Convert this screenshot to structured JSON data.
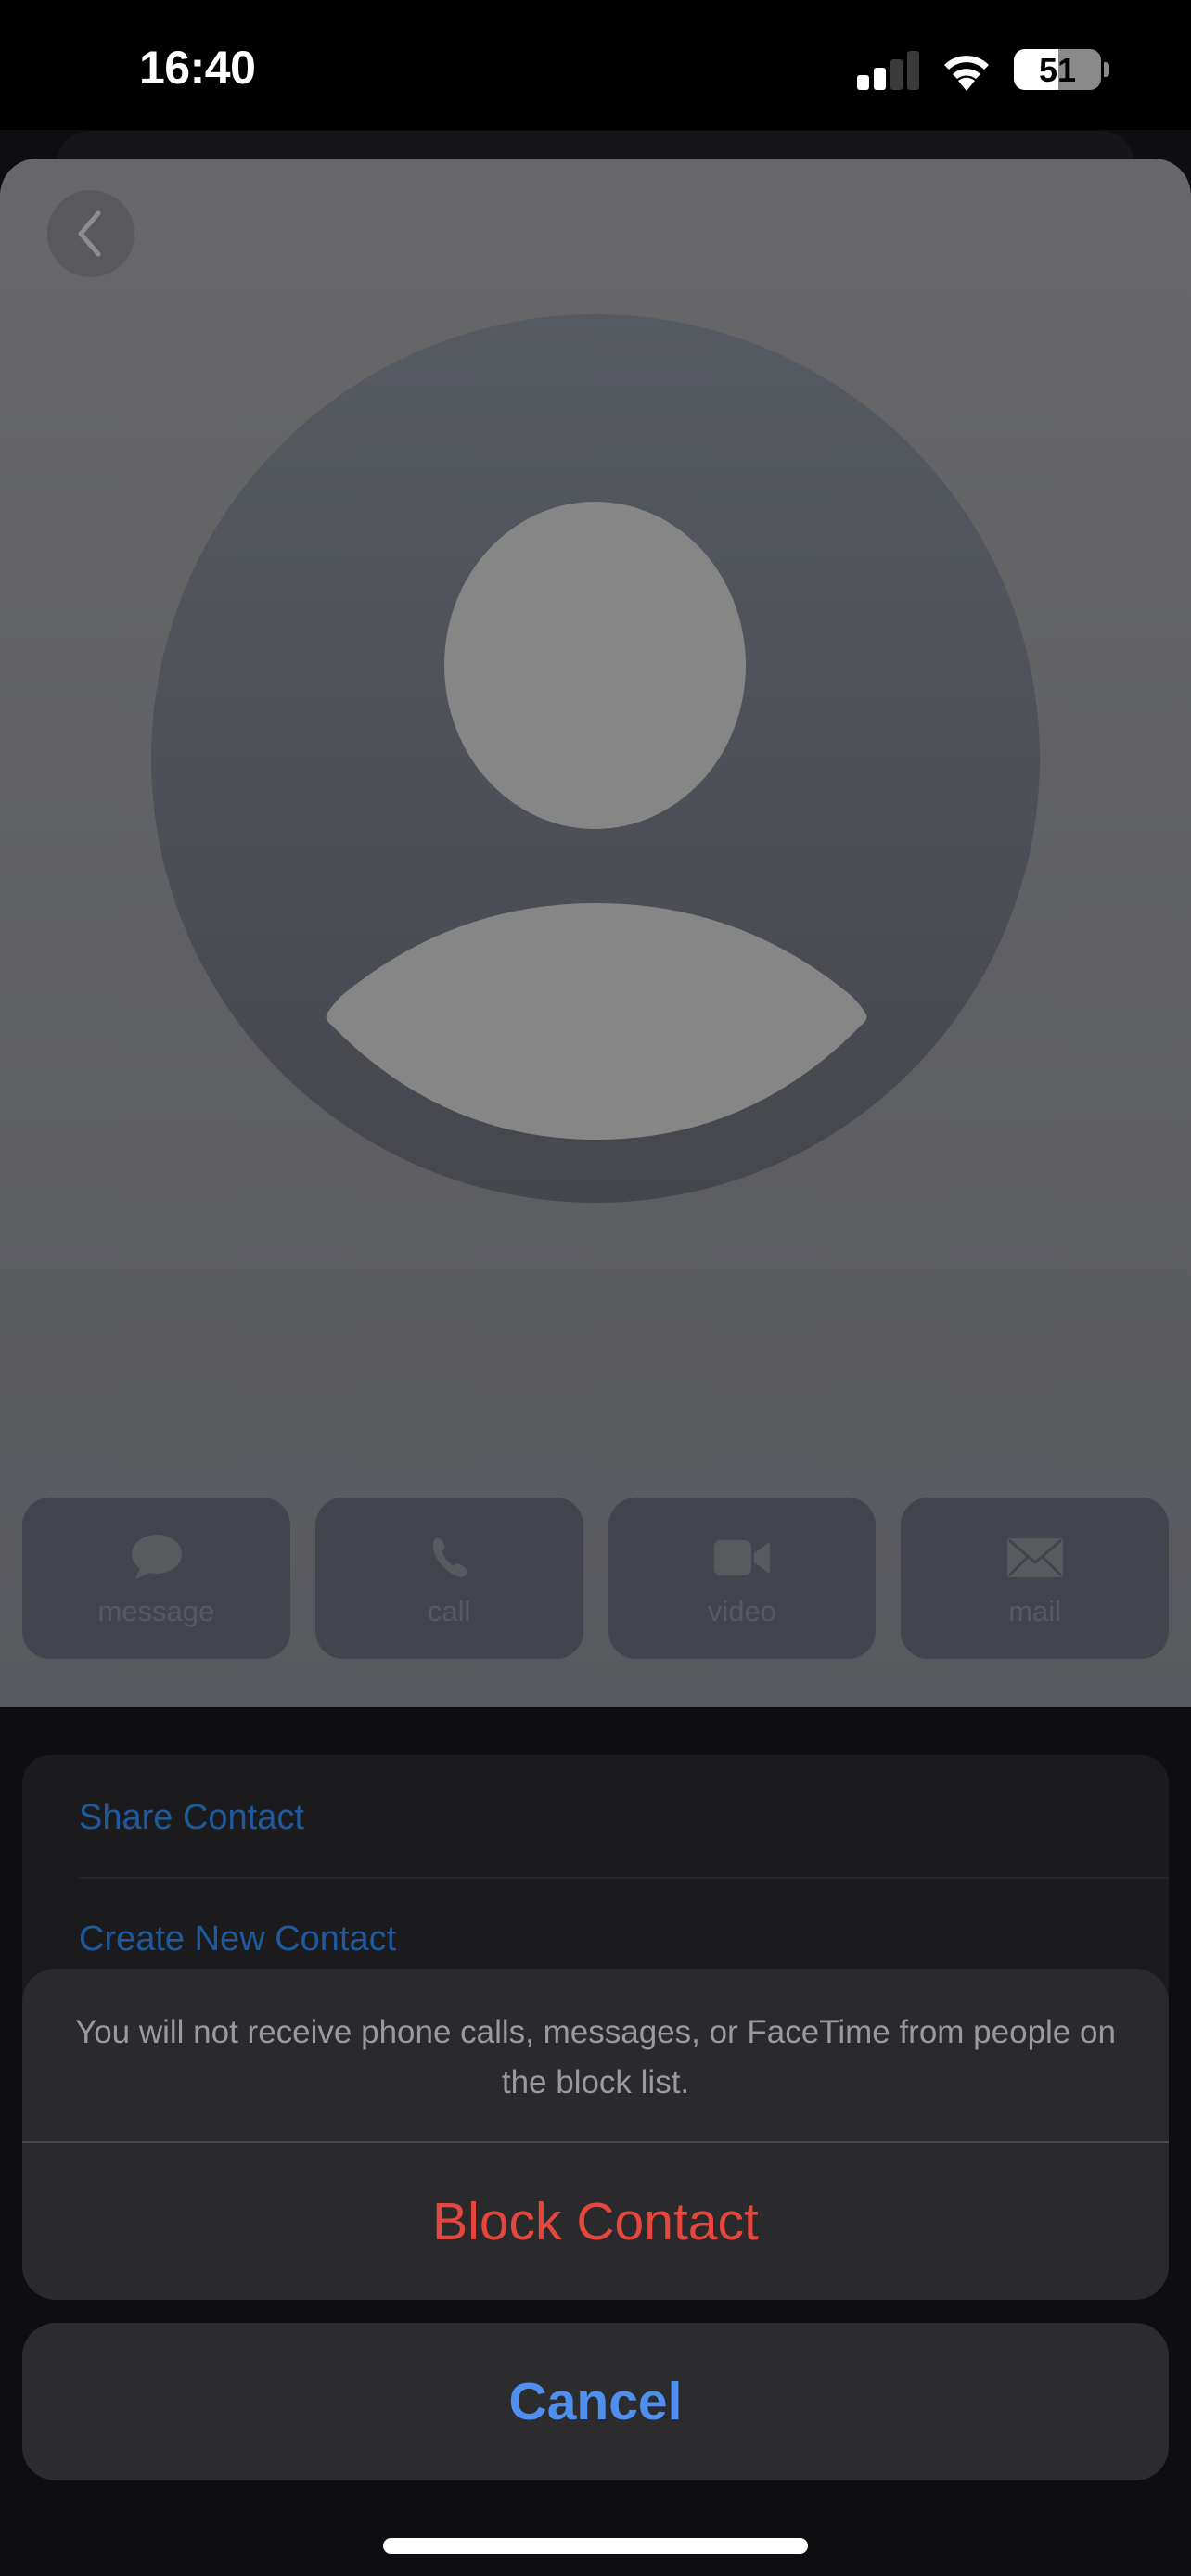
{
  "status_bar": {
    "time": "16:40",
    "signal_bars_active": 2,
    "signal_bars_total": 4,
    "wifi_icon": "wifi-icon",
    "battery_percent": 51,
    "battery_label": "51"
  },
  "contact_card": {
    "back_icon": "chevron-left-icon",
    "avatar_icon": "person-placeholder-icon",
    "actions": [
      {
        "label": "message",
        "icon": "message-bubble-icon"
      },
      {
        "label": "call",
        "icon": "phone-icon"
      },
      {
        "label": "video",
        "icon": "video-camera-icon"
      },
      {
        "label": "mail",
        "icon": "envelope-icon"
      }
    ]
  },
  "list": {
    "items": [
      {
        "label": "Share Contact"
      },
      {
        "label": "Create New Contact"
      }
    ]
  },
  "action_sheet": {
    "message": "You will not receive phone calls, messages, or FaceTime from people on the block list.",
    "destructive_label": "Block Contact",
    "cancel_label": "Cancel"
  },
  "colors": {
    "link_blue_dimmed": "#1f5a9e",
    "destructive_red": "#e5473f",
    "cancel_blue": "#4e8ff0",
    "sheet_bg": "#2a2a2c"
  }
}
